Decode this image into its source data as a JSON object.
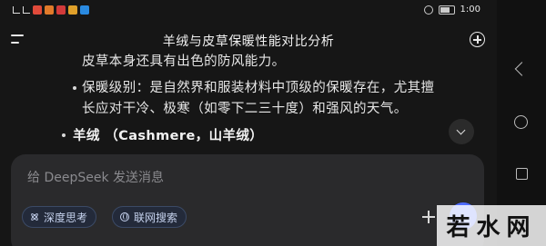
{
  "status_bar": {
    "time": "1:00",
    "battery_level": 0.7
  },
  "header": {
    "title": "羊绒与皮草保暖性能对比分析",
    "menu_icon": "menu-icon",
    "new_chat_icon": "new-chat-icon"
  },
  "message": {
    "lines": [
      {
        "text": "皮草本身还具有出色的防风能力。"
      },
      {
        "label": "保暖级别：",
        "text": "是自然界和服装材料中顶级的保暖存在，尤其擅"
      },
      {
        "text": "长应对干冷、极寒（如零下二三十度）和强风的天气。"
      },
      {
        "heading_cn": "羊绒",
        "heading_rest": "（Cashmere，山羊绒）"
      }
    ]
  },
  "input": {
    "placeholder": "给 DeepSeek 发送消息",
    "value": ""
  },
  "chips": {
    "deep_think": "深度思考",
    "web_search": "联网搜索"
  },
  "watermark": {
    "text": "若水网"
  },
  "colors": {
    "background": "#161616",
    "input_card": "#2a2a2c",
    "chip_bg": "#232a3a",
    "chip_text": "#c6d2ee",
    "send_button": "#4d6bfe"
  }
}
